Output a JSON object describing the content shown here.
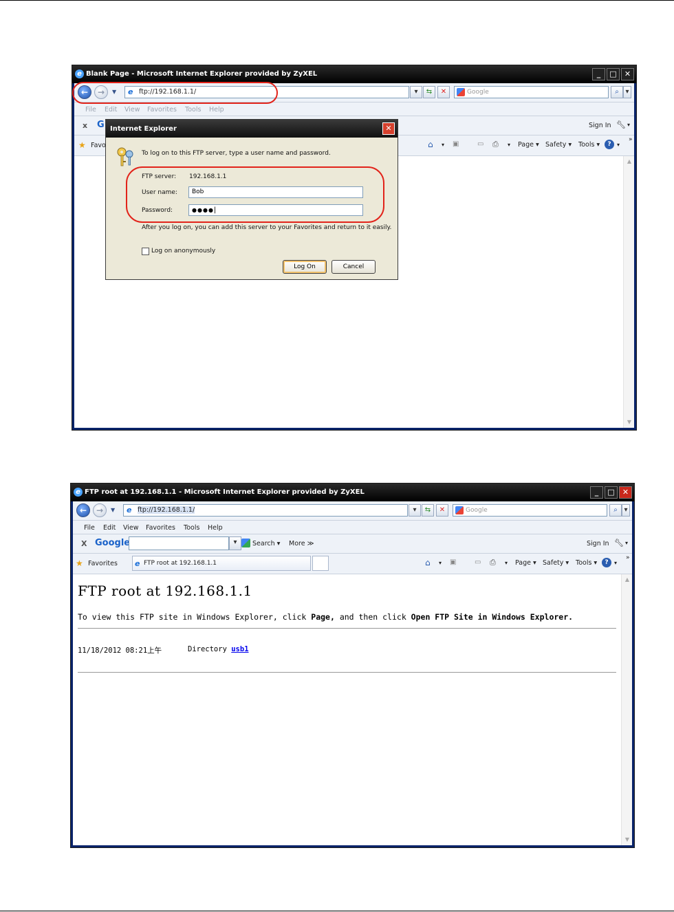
{
  "top_window": {
    "title": "Blank Page - Microsoft Internet Explorer provided by ZyXEL",
    "address": "ftp://192.168.1.1/",
    "search_placeholder": "Google",
    "menu": [
      "File",
      "Edit",
      "View",
      "Favorites",
      "Tools",
      "Help"
    ],
    "google_toolbar_close": "x",
    "sign_in": "Sign In",
    "favorites_label": "Favo",
    "commands": {
      "page": "Page ▾",
      "safety": "Safety ▾",
      "tools": "Tools ▾"
    }
  },
  "login_dialog": {
    "title": "Internet Explorer",
    "instruction": "To log on to this FTP server, type a user name and password.",
    "server_label": "FTP server:",
    "server_value": "192.168.1.1",
    "username_label": "User name:",
    "username_value": "Bob",
    "password_label": "Password:",
    "password_value": "●●●●",
    "favorites_note": "After you log on, you can add this server to your Favorites and return to it easily.",
    "anonymous_label": "Log on anonymously",
    "logon_button": "Log On",
    "cancel_button": "Cancel"
  },
  "bottom_window": {
    "title": "FTP root at 192.168.1.1 - Microsoft Internet Explorer provided by ZyXEL",
    "address": "ftp://192.168.1.1/",
    "search_placeholder": "Google",
    "menu": [
      "File",
      "Edit",
      "View",
      "Favorites",
      "Tools",
      "Help"
    ],
    "google_toolbar_close": "X",
    "google_logo": "Google",
    "search_label": "Search ▾",
    "more_label": "More ≫",
    "sign_in": "Sign In",
    "favorites_label": "Favorites",
    "tab_label": "FTP root at 192.168.1.1",
    "commands": {
      "page": "Page ▾",
      "safety": "Safety ▾",
      "tools": "Tools ▾"
    }
  },
  "ftp_page": {
    "heading": "FTP root at 192.168.1.1",
    "info_prefix": "To view this FTP site in Windows Explorer, click ",
    "info_page": "Page,",
    "info_middle": " and then click ",
    "info_open": "Open FTP Site in Windows Explorer.",
    "entry_date": "11/18/2012 08:21上午",
    "entry_type": "Directory",
    "entry_name": "usb1"
  },
  "colors": {
    "highlight_oval": "#e2231a",
    "link": "#0000ee"
  }
}
